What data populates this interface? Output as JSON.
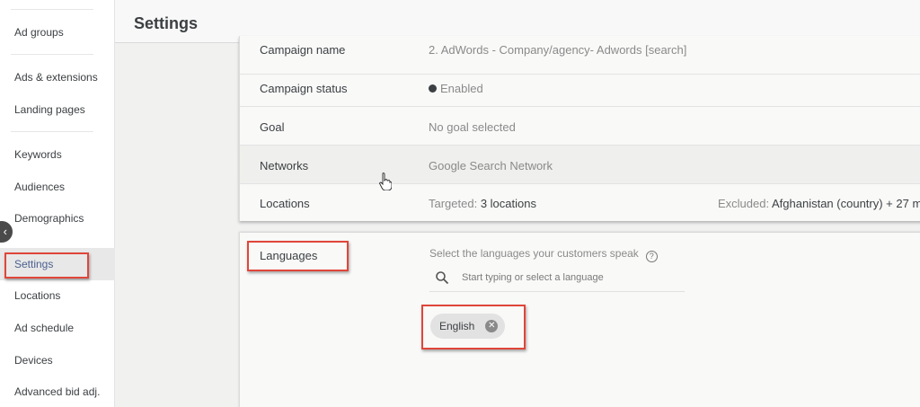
{
  "sidebar": {
    "items": [
      {
        "label": "Ad groups"
      },
      {
        "label": "Ads & extensions"
      },
      {
        "label": "Landing pages"
      },
      {
        "label": "Keywords"
      },
      {
        "label": "Audiences"
      },
      {
        "label": "Demographics"
      },
      {
        "label": "Settings"
      },
      {
        "label": "Locations"
      },
      {
        "label": "Ad schedule"
      },
      {
        "label": "Devices"
      },
      {
        "label": "Advanced bid adj."
      }
    ],
    "active": "Settings"
  },
  "header": {
    "title": "Settings"
  },
  "settings": {
    "rows": [
      {
        "label": "Campaign name",
        "value": "2. AdWords - Company/agency- Adwords [search]"
      },
      {
        "label": "Campaign status",
        "value": "Enabled"
      },
      {
        "label": "Goal",
        "value": "No goal selected"
      },
      {
        "label": "Networks",
        "value": "Google Search Network"
      },
      {
        "label": "Locations",
        "targeted_prefix": "Targeted:",
        "targeted_value": "3 locations",
        "excluded_prefix": "Excluded:",
        "excluded_value": "Afghanistan (country) + 27 m"
      }
    ]
  },
  "languages": {
    "label": "Languages",
    "help_text": "Select the languages your customers speak",
    "search_placeholder": "Start typing or select a language",
    "selected": [
      {
        "label": "English"
      }
    ]
  },
  "colors": {
    "highlight": "#e0463a",
    "text": "#3c4043",
    "muted": "#8a8a8a"
  },
  "icons": {
    "collapse": "chevron-left-icon",
    "search": "search-icon",
    "help": "help-circle-icon",
    "chip_remove": "close-circle-icon",
    "cursor": "hand-pointer-icon"
  }
}
